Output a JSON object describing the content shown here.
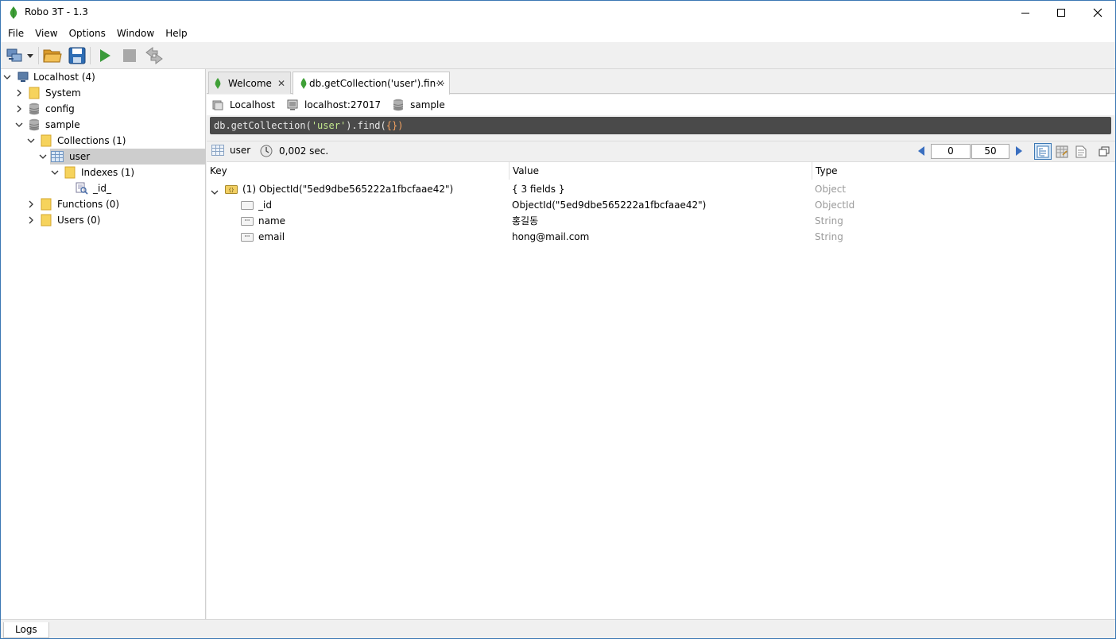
{
  "window": {
    "title": "Robo 3T - 1.3"
  },
  "menu": [
    "File",
    "View",
    "Options",
    "Window",
    "Help"
  ],
  "tree": {
    "root": "Localhost (4)",
    "system": "System",
    "config": "config",
    "sample": "sample",
    "collections": "Collections (1)",
    "user": "user",
    "indexes": "Indexes (1)",
    "index_id": "_id_",
    "functions": "Functions (0)",
    "users": "Users (0)"
  },
  "tabs": [
    {
      "label": "Welcome"
    },
    {
      "label": "db.getCollection('user').fin···"
    }
  ],
  "connection": {
    "host": "Localhost",
    "address": "localhost:27017",
    "database": "sample"
  },
  "query": {
    "prefix": "db.getCollection(",
    "arg": "'user'",
    "mid": ").find(",
    "braces": "{}",
    "suffix": ")"
  },
  "result": {
    "collection": "user",
    "time": "0,002 sec.",
    "skip": "0",
    "limit": "50"
  },
  "grid": {
    "headers": {
      "key": "Key",
      "value": "Value",
      "type": "Type"
    },
    "rows": [
      {
        "key": "(1) ObjectId(\"5ed9dbe565222a1fbcfaae42\")",
        "value": "{ 3 fields }",
        "type": "Object"
      },
      {
        "key": "_id",
        "value": "ObjectId(\"5ed9dbe565222a1fbcfaae42\")",
        "type": "ObjectId"
      },
      {
        "key": "name",
        "value": "홍길동",
        "type": "String"
      },
      {
        "key": "email",
        "value": "hong@mail.com",
        "type": "String"
      }
    ]
  },
  "logs": {
    "label": "Logs"
  },
  "colors": {
    "accent": "#3c78b4",
    "leaf": "#3fa037",
    "query_bg": "#4a4a4a",
    "folder": "#f6d35c"
  }
}
